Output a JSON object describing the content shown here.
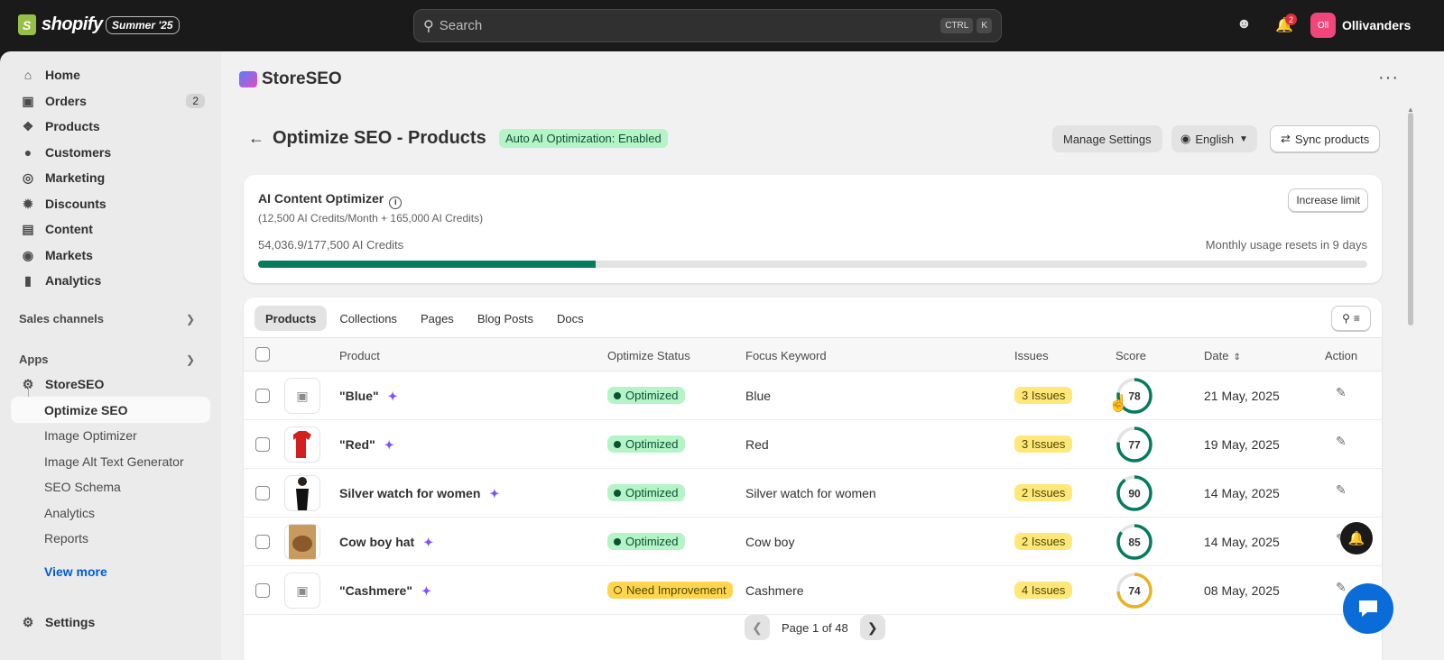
{
  "topbar": {
    "brand": "shopify",
    "edition_badge": "Summer '25",
    "search_placeholder": "Search",
    "shortcut_ctrl": "CTRL",
    "shortcut_key": "K",
    "notification_count": "2",
    "store_initials": "Oll",
    "store_name": "Ollivanders"
  },
  "sidebar": {
    "items": [
      {
        "label": "Home",
        "icon": "home-icon"
      },
      {
        "label": "Orders",
        "icon": "orders-icon",
        "count": "2"
      },
      {
        "label": "Products",
        "icon": "tag-icon"
      },
      {
        "label": "Customers",
        "icon": "person-icon"
      },
      {
        "label": "Marketing",
        "icon": "target-icon"
      },
      {
        "label": "Discounts",
        "icon": "discount-icon"
      },
      {
        "label": "Content",
        "icon": "content-icon"
      },
      {
        "label": "Markets",
        "icon": "globe-icon"
      },
      {
        "label": "Analytics",
        "icon": "bar-chart-icon"
      }
    ],
    "sales_channels_label": "Sales channels",
    "apps_label": "Apps",
    "app_name": "StoreSEO",
    "app_subitems": [
      "Optimize SEO",
      "Image Optimizer",
      "Image Alt Text Generator",
      "SEO Schema",
      "Analytics",
      "Reports"
    ],
    "view_more": "View more",
    "settings": "Settings"
  },
  "app": {
    "title": "StoreSEO"
  },
  "page": {
    "title": "Optimize SEO - Products",
    "status_badge": "Auto AI Optimization: Enabled",
    "manage_settings": "Manage Settings",
    "language": "English",
    "sync_products": "Sync products"
  },
  "credits": {
    "title": "AI Content Optimizer",
    "subtitle": "(12,500 AI Credits/Month + 165,000 AI Credits)",
    "used_text": "54,036.9/177,500 AI Credits",
    "reset_text": "Monthly usage resets in 9 days",
    "increase_limit": "Increase limit",
    "used": 54036.9,
    "total": 177500
  },
  "tabs": [
    "Products",
    "Collections",
    "Pages",
    "Blog Posts",
    "Docs"
  ],
  "table": {
    "headers": {
      "product": "Product",
      "status": "Optimize Status",
      "keyword": "Focus Keyword",
      "issues": "Issues",
      "score": "Score",
      "date": "Date",
      "action": "Action"
    },
    "rows": [
      {
        "name": "\"Blue\"",
        "status": "Optimized",
        "status_type": "ok",
        "keyword": "Blue",
        "issues": "3 Issues",
        "score": "78",
        "score_color": "#047b5d",
        "date": "21 May, 2025",
        "thumb": "placeholder"
      },
      {
        "name": "\"Red\"",
        "status": "Optimized",
        "status_type": "ok",
        "keyword": "Red",
        "issues": "3 Issues",
        "score": "77",
        "score_color": "#047b5d",
        "date": "19 May, 2025",
        "thumb": "red-shirt"
      },
      {
        "name": "Silver watch for women",
        "status": "Optimized",
        "status_type": "ok",
        "keyword": "Silver watch for women",
        "issues": "2 Issues",
        "score": "90",
        "score_color": "#047b5d",
        "date": "14 May, 2025",
        "thumb": "woman"
      },
      {
        "name": "Cow boy hat",
        "status": "Optimized",
        "status_type": "ok",
        "keyword": "Cow boy",
        "issues": "2 Issues",
        "score": "85",
        "score_color": "#047b5d",
        "date": "14 May, 2025",
        "thumb": "hat"
      },
      {
        "name": "\"Cashmere\"",
        "status": "Need Improvement",
        "status_type": "warn",
        "keyword": "Cashmere",
        "issues": "4 Issues",
        "score": "74",
        "score_color": "#e8b321",
        "date": "08 May, 2025",
        "thumb": "placeholder"
      }
    ]
  },
  "pagination": {
    "label": "Page 1 of 48"
  },
  "colors": {
    "brand_green": "#047b5d",
    "optimized_bg": "#b4f4c7",
    "warning_bg": "#ffd54f",
    "issue_bg": "#ffe77a",
    "chat_blue": "#0a6cd8"
  }
}
